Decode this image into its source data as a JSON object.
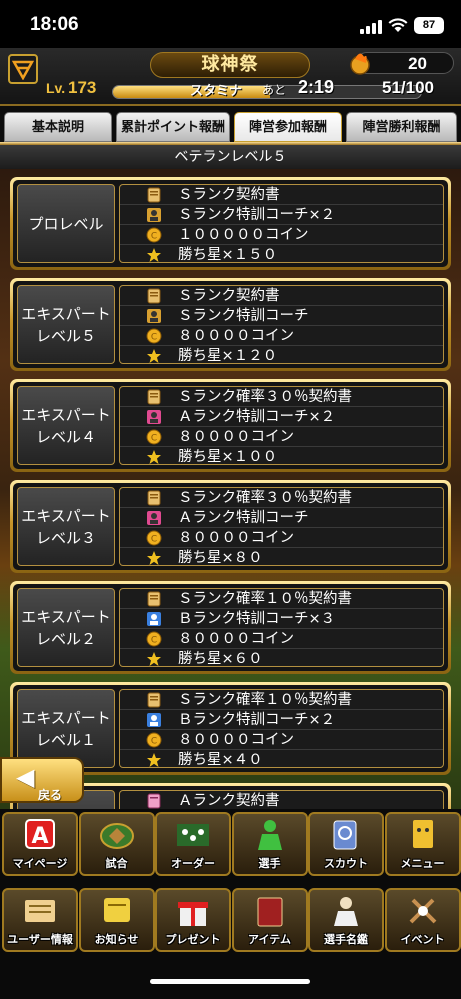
{
  "status": {
    "time": "18:06",
    "battery": "87"
  },
  "header": {
    "title": "球神祭",
    "coins": "20"
  },
  "stats": {
    "lv_label": "Lv.",
    "level": "173",
    "stamina_label": "スタミナ",
    "remaining_label": "あと",
    "remaining_time": "2:19",
    "stamina_count": "51/100",
    "stamina_fraction": 0.51
  },
  "tabs": [
    {
      "label": "基本説明",
      "active": false
    },
    {
      "label": "累計ポイント報酬",
      "active": false
    },
    {
      "label": "陣営参加報酬",
      "active": true
    },
    {
      "label": "陣営勝利報酬",
      "active": false
    }
  ],
  "section_title": "ベテランレベル５",
  "rewards": [
    {
      "level": "プロレベル",
      "items": [
        {
          "icon": "contract-icon",
          "text": "Ｓランク契約書"
        },
        {
          "icon": "coach-icon-s",
          "text": "Ｓランク特訓コーチ×２"
        },
        {
          "icon": "coin-icon",
          "text": "１０００００コイン"
        },
        {
          "icon": "star-icon",
          "text": "勝ち星×１５０"
        }
      ]
    },
    {
      "level": "エキスパート\nレベル５",
      "items": [
        {
          "icon": "contract-icon",
          "text": "Ｓランク契約書"
        },
        {
          "icon": "coach-icon-s",
          "text": "Ｓランク特訓コーチ"
        },
        {
          "icon": "coin-icon",
          "text": "８００００コイン"
        },
        {
          "icon": "star-icon",
          "text": "勝ち星×１２０"
        }
      ]
    },
    {
      "level": "エキスパート\nレベル４",
      "items": [
        {
          "icon": "contract-icon",
          "text": "Ｓランク確率３０％契約書"
        },
        {
          "icon": "coach-icon-a",
          "text": "Ａランク特訓コーチ×２"
        },
        {
          "icon": "coin-icon",
          "text": "８００００コイン"
        },
        {
          "icon": "star-icon",
          "text": "勝ち星×１００"
        }
      ]
    },
    {
      "level": "エキスパート\nレベル３",
      "items": [
        {
          "icon": "contract-icon",
          "text": "Ｓランク確率３０％契約書"
        },
        {
          "icon": "coach-icon-a",
          "text": "Ａランク特訓コーチ"
        },
        {
          "icon": "coin-icon",
          "text": "８００００コイン"
        },
        {
          "icon": "star-icon",
          "text": "勝ち星×８０"
        }
      ]
    },
    {
      "level": "エキスパート\nレベル２",
      "items": [
        {
          "icon": "contract-icon",
          "text": "Ｓランク確率１０％契約書"
        },
        {
          "icon": "coach-icon-b",
          "text": "Ｂランク特訓コーチ×３"
        },
        {
          "icon": "coin-icon",
          "text": "８００００コイン"
        },
        {
          "icon": "star-icon",
          "text": "勝ち星×６０"
        }
      ]
    },
    {
      "level": "エキスパート\nレベル１",
      "items": [
        {
          "icon": "contract-icon",
          "text": "Ｓランク確率１０％契約書"
        },
        {
          "icon": "coach-icon-b",
          "text": "Ｂランク特訓コーチ×２"
        },
        {
          "icon": "coin-icon",
          "text": "８００００コイン"
        },
        {
          "icon": "star-icon",
          "text": "勝ち星×４０"
        }
      ]
    },
    {
      "level": "",
      "items": [
        {
          "icon": "contract-icon-pink",
          "text": "Ａランク契約書"
        }
      ]
    }
  ],
  "back_label": "戻る",
  "nav_primary": [
    {
      "label": "マイページ",
      "icon": "mypage-icon"
    },
    {
      "label": "試合",
      "icon": "stadium-icon"
    },
    {
      "label": "オーダー",
      "icon": "order-icon"
    },
    {
      "label": "選手",
      "icon": "player-icon"
    },
    {
      "label": "スカウト",
      "icon": "scout-icon"
    },
    {
      "label": "メニュー",
      "icon": "menu-icon"
    }
  ],
  "nav_secondary": [
    {
      "label": "ユーザー情報",
      "icon": "user-info-icon"
    },
    {
      "label": "お知らせ",
      "icon": "notice-icon"
    },
    {
      "label": "プレゼント",
      "icon": "present-icon"
    },
    {
      "label": "アイテム",
      "icon": "item-icon"
    },
    {
      "label": "選手名鑑",
      "icon": "directory-icon"
    },
    {
      "label": "イベント",
      "icon": "event-icon"
    }
  ]
}
